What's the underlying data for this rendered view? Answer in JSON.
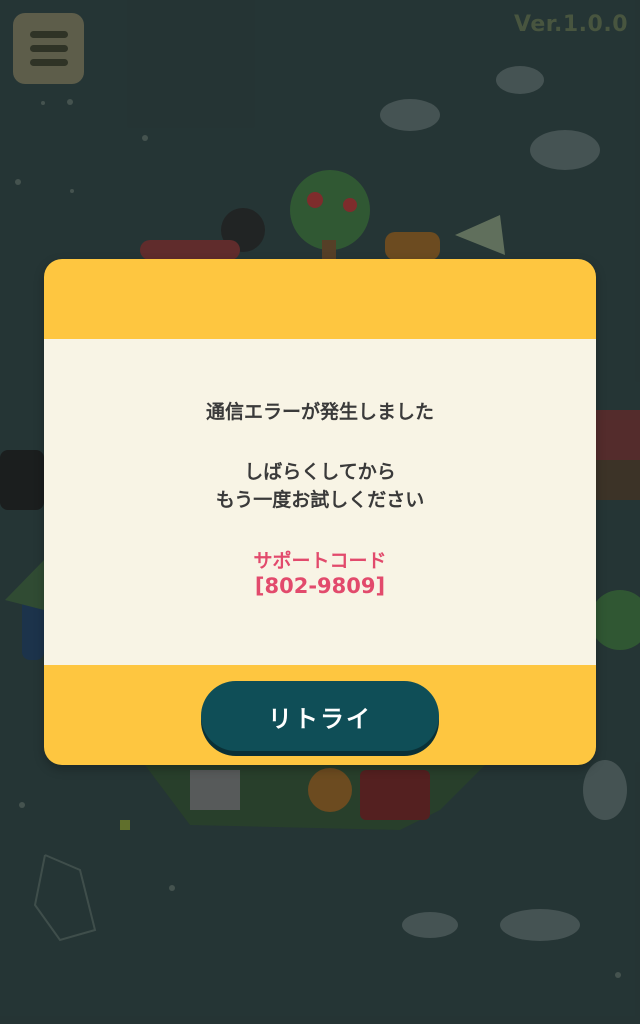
{
  "header": {
    "version": "Ver.1.0.0"
  },
  "dialog": {
    "message_line1": "通信エラーが発生しました",
    "message_line2": "しばらくしてから",
    "message_line3": "もう一度お試しください",
    "support_code_label": "サポートコード",
    "support_code_value": "[802-9809]",
    "retry_label": "リトライ"
  },
  "colors": {
    "background": "#2b3c3c",
    "dialog_frame": "#fec640",
    "dialog_panel": "#f8f4e5",
    "button": "#0f4e57",
    "support_code": "#e24a6c"
  },
  "icons": {
    "menu": "hamburger-menu-icon"
  }
}
